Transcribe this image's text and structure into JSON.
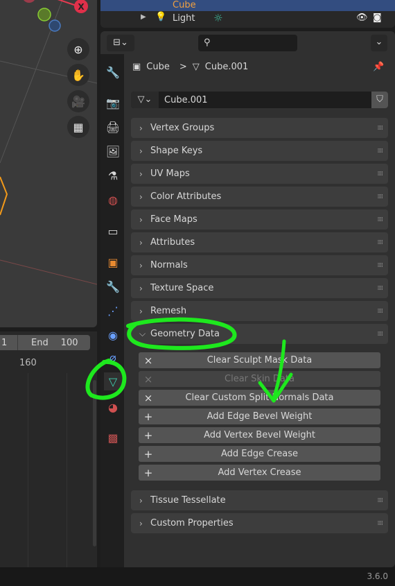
{
  "outliner": {
    "rows": [
      {
        "label": "Cube",
        "selected": true
      },
      {
        "label": "Light",
        "selected": false
      }
    ]
  },
  "timeline": {
    "start_value": "1",
    "end_label": "End",
    "end_value": "100",
    "frame_marker": "160"
  },
  "header": {
    "search_placeholder": ""
  },
  "breadcrumb": {
    "object": "Cube",
    "separator": ">",
    "data": "Cube.001"
  },
  "datablock": {
    "name": "Cube.001"
  },
  "panels": {
    "before": [
      "Vertex Groups",
      "Shape Keys",
      "UV Maps",
      "Color Attributes",
      "Face Maps",
      "Attributes",
      "Normals",
      "Texture Space",
      "Remesh"
    ],
    "open": {
      "label": "Geometry Data",
      "buttons": [
        {
          "icon": "×",
          "label": "Clear Sculpt Mask Data",
          "enabled": true
        },
        {
          "icon": "×",
          "label": "Clear Skin Data",
          "enabled": false
        },
        {
          "icon": "×",
          "label": "Clear Custom Split Normals Data",
          "enabled": true
        },
        {
          "icon": "+",
          "label": "Add Edge Bevel Weight",
          "enabled": true
        },
        {
          "icon": "+",
          "label": "Add Vertex Bevel Weight",
          "enabled": true
        },
        {
          "icon": "+",
          "label": "Add Edge Crease",
          "enabled": true
        },
        {
          "icon": "+",
          "label": "Add Vertex Crease",
          "enabled": true
        }
      ]
    },
    "after": [
      "Tissue Tessellate",
      "Custom Properties"
    ]
  },
  "status": {
    "version": "3.6.0"
  },
  "colors": {
    "annotation": "#1ee81e",
    "accent_selected": "#334d80",
    "mesh_tab": "#3fd0b0"
  }
}
